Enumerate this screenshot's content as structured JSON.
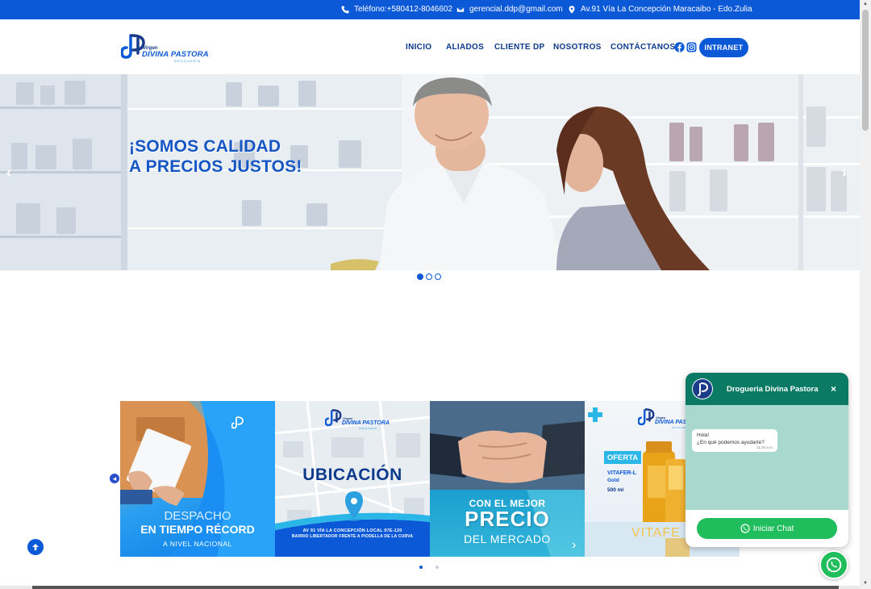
{
  "topbar": {
    "phone": "Teléfono:+580412-8046602",
    "email": "gerencial.ddp@gmail.com",
    "address": "Av.91 Vía La Concepción Maracaibo - Edo.Zulia"
  },
  "logo": {
    "small": "Virgen",
    "brand": "DIVINA PASTORA",
    "tag": "DROGUERÍA"
  },
  "nav": {
    "items": [
      "INICIO",
      "ALIADOS",
      "CLIENTE DP",
      "NOSOTROS",
      "CONTÁCTANOS"
    ],
    "button": "INTRANET",
    "social_icons": [
      "facebook-icon",
      "instagram-icon"
    ]
  },
  "hero": {
    "line1": "¡SOMOS CALIDAD",
    "line2": "A PRECIOS JUSTOS!",
    "prev": "‹",
    "next": "›",
    "active_slide": 1,
    "slide_count": 3
  },
  "cards": [
    {
      "line1": "DESPACHO",
      "line2": "EN TIEMPO RÉCORD",
      "line3": "A NIVEL NACIONAL"
    },
    {
      "logo_small": "Virgen",
      "logo_brand": "DIVINA PASTORA",
      "logo_tag": "DROGUERÍA",
      "title": "UBICACIÓN",
      "line1": "AV 91 VÍA LA CONCEPCIÓN LOCAL 97E-120",
      "line2": "BARRIO LIBERTADOR FRENTE A PIODELLA DE LA CURVA"
    },
    {
      "line1": "CON EL MEJOR",
      "line2": "PRECIO",
      "line3": "DEL MERCADO"
    },
    {
      "logo_small": "Virgen",
      "logo_brand": "DIVINA PASTORA",
      "logo_tag": "DROGUERÍA",
      "badge": "OFERTA",
      "product": "VITAFER-L",
      "product2": "Gold",
      "size": "500 ml",
      "bottom": "VITAFE"
    }
  ],
  "carousel": {
    "next": "›",
    "prev": "◂"
  },
  "chat": {
    "name": "Drogueria Divina Pastora",
    "close": "×",
    "greeting": "Hola!",
    "question": "¿En qué podemos ayudarte?",
    "time": "11:26 a.m.",
    "button": "Iniciar Chat"
  },
  "colors": {
    "primary": "#0b59d6",
    "navy": "#0d3a8c",
    "whatsapp": "#1fbd5b",
    "chat_header": "#0a7a64"
  }
}
